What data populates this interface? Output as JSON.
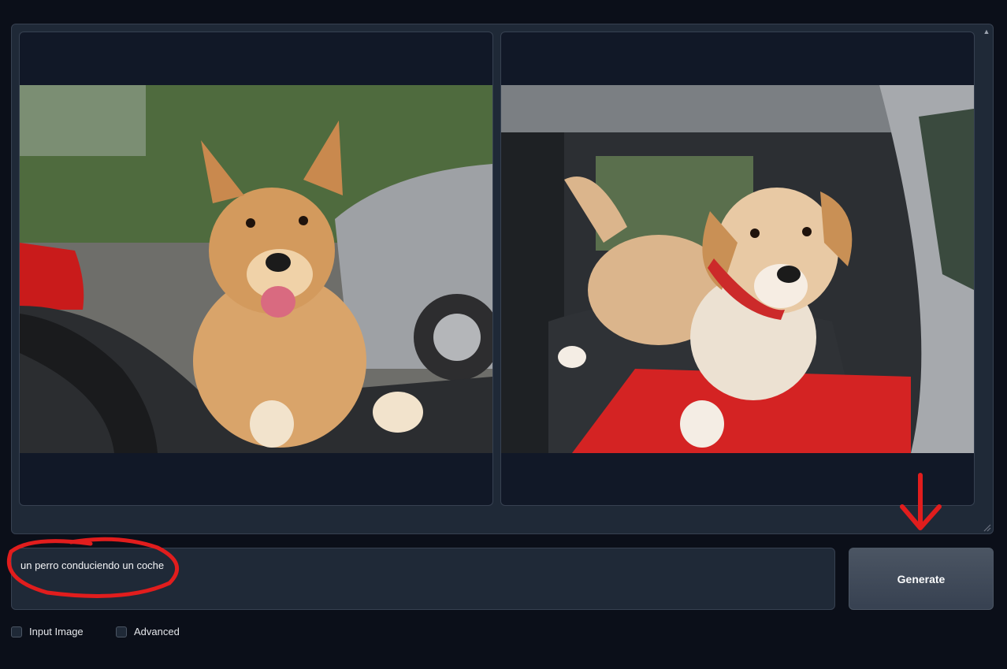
{
  "gallery": {
    "images": [
      {
        "alt_icon": "dog-image-icon"
      },
      {
        "alt_icon": "dog-image-icon"
      }
    ]
  },
  "prompt": {
    "value": "un perro conduciendo un coche"
  },
  "generate": {
    "label": "Generate"
  },
  "options": {
    "input_image": "Input Image",
    "advanced": "Advanced"
  },
  "colors": {
    "background": "#0b0f19",
    "panel": "#1f2937",
    "annotation": "#e11d1d"
  }
}
